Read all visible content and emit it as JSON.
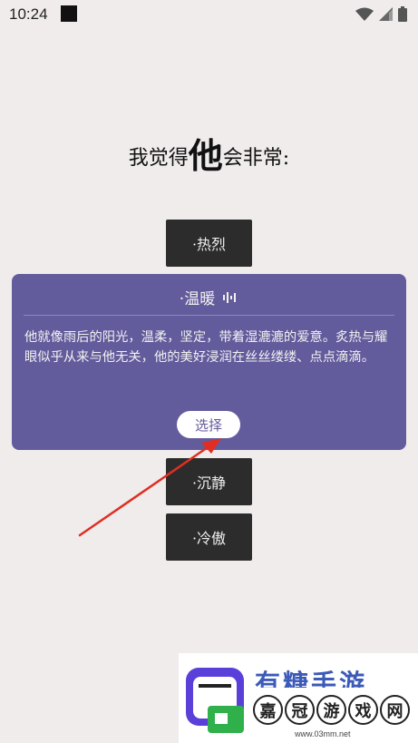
{
  "status": {
    "time": "10:24"
  },
  "prompt": {
    "before": "我觉得",
    "emphasis": "他",
    "after": "会非常:"
  },
  "options": [
    "·热烈",
    "·沉静",
    "·冷傲"
  ],
  "card": {
    "title": "·温暖",
    "description": "他就像雨后的阳光，温柔，坚定，带着湿漉漉的爱意。炙热与耀眼似乎从来与他无关，他的美好浸润在丝丝缕缕、点点滴滴。",
    "button": "选择"
  },
  "watermark": {
    "name": "有糖手游",
    "chars": [
      "嘉",
      "冠",
      "游",
      "戏",
      "网"
    ],
    "url": "www.03mm.net"
  }
}
